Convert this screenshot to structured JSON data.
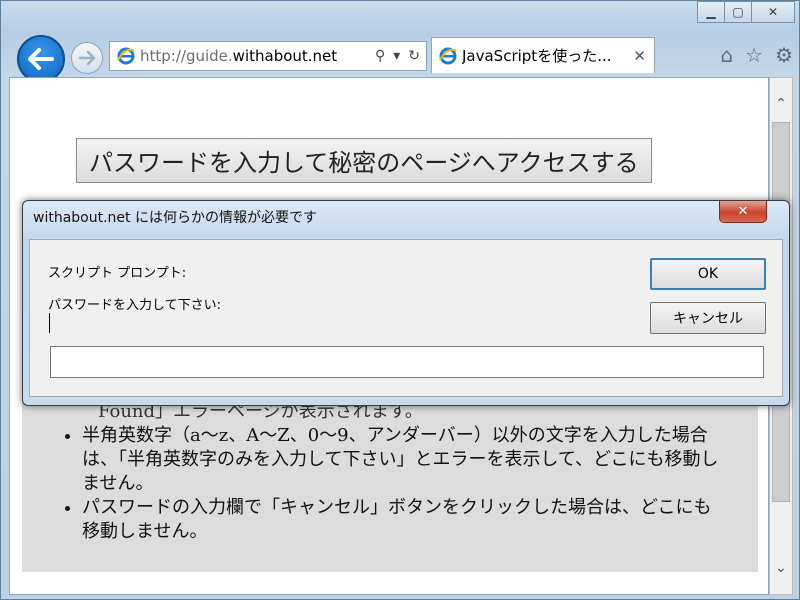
{
  "browser": {
    "address": {
      "url_prefix": "http://guide.",
      "url_host": "withabout.net"
    },
    "tab": {
      "title": "JavaScriptを使った..."
    }
  },
  "page": {
    "access_button_label": "パスワードを入力して秘密のページへアクセスする",
    "partial_line": "Found」エラーページが表示されます。",
    "bullets": [
      "半角英数字（a～z、A～Z、0～9、アンダーバー）以外の文字を入力した場合は、「半角英数字のみを入力して下さい」とエラーを表示して、どこにも移動しません。",
      "パスワードの入力欄で「キャンセル」ボタンをクリックした場合は、どこにも移動しません。"
    ]
  },
  "dialog": {
    "title": "withabout.net には何らかの情報が必要です",
    "label1": "スクリプト プロンプト:",
    "label2": "パスワードを入力して下さい:",
    "ok_label": "OK",
    "cancel_label": "キャンセル",
    "input_value": "",
    "close_glyph": "✕"
  },
  "icons": {
    "back": "back-arrow-icon",
    "forward": "forward-arrow-icon",
    "ie": "ie-logo-icon",
    "search": "search-icon",
    "refresh": "refresh-icon",
    "home": "home-icon",
    "favorites": "star-icon",
    "tools": "gear-icon"
  },
  "colors": {
    "back_button": "#0a64c0",
    "dialog_close": "#c8432d",
    "content_grey": "#dcdcdc"
  }
}
